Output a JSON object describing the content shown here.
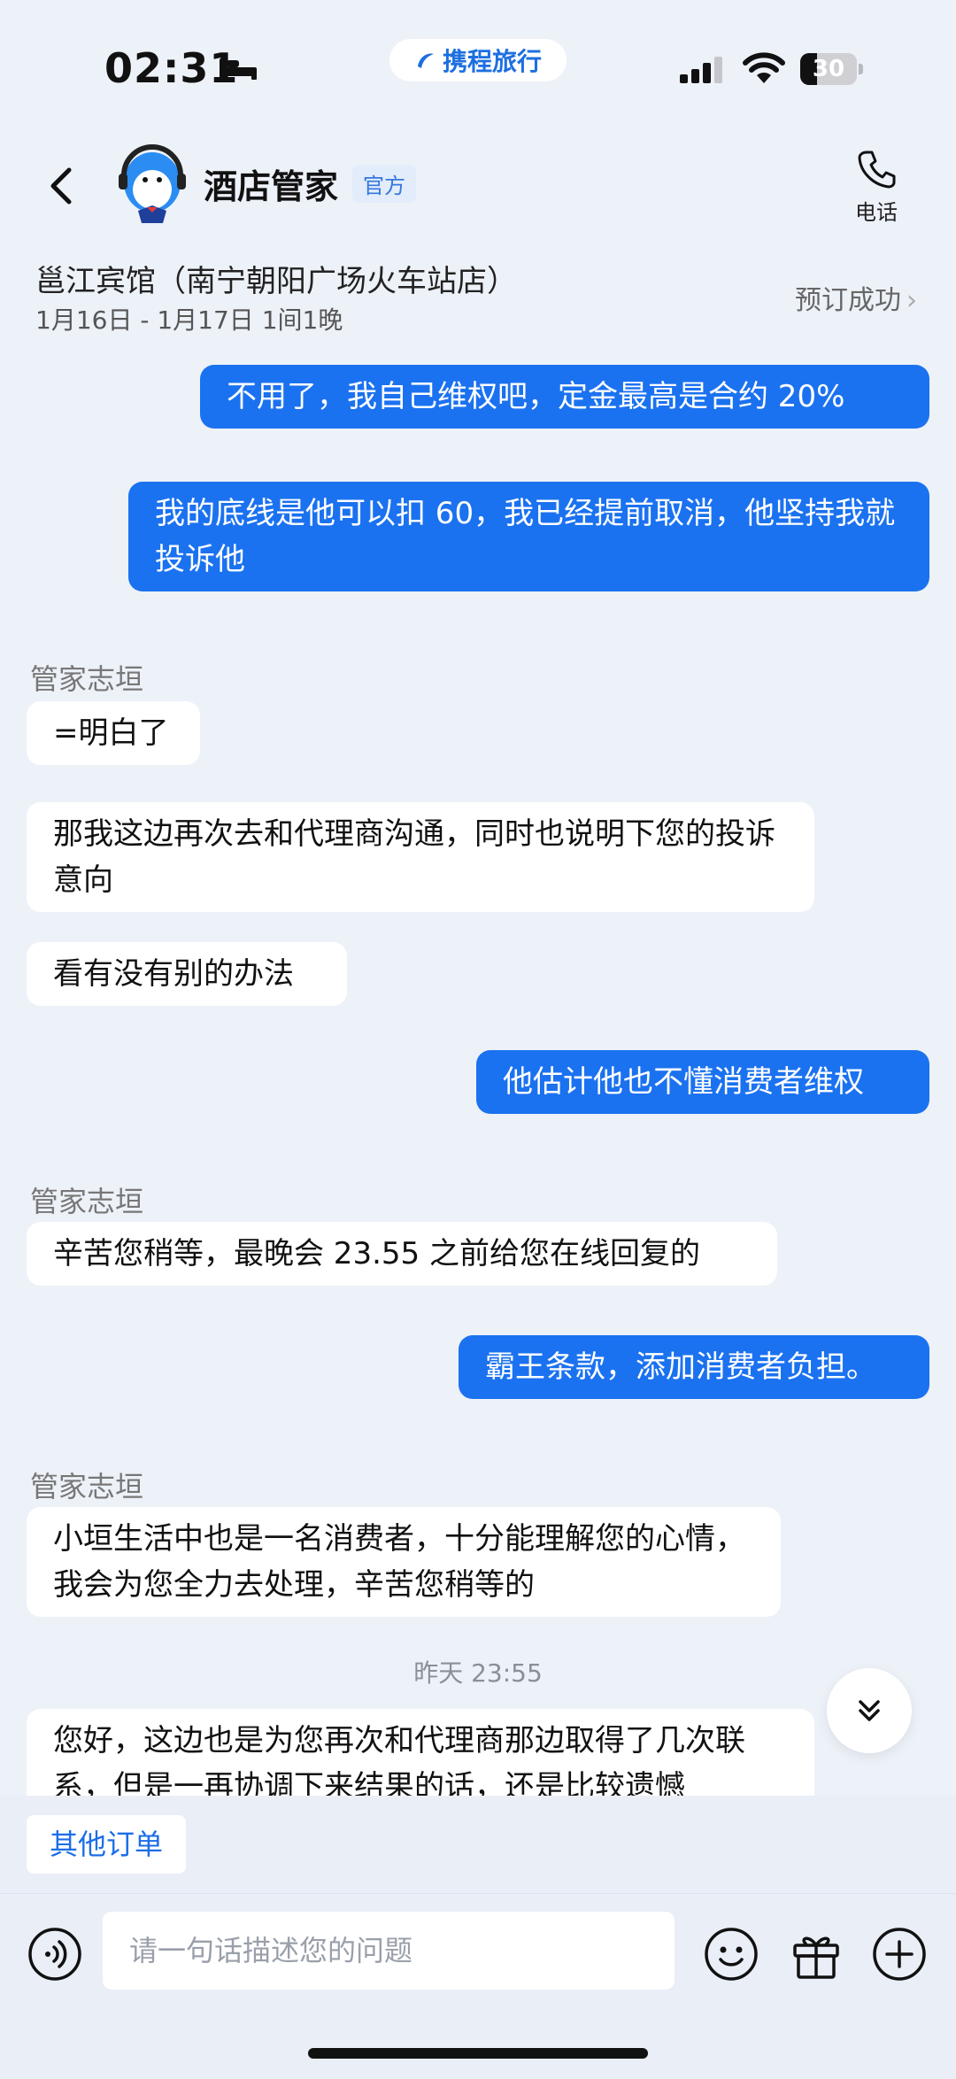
{
  "status_bar": {
    "time": "02:31",
    "battery": "30",
    "app_name": "携程旅行"
  },
  "header": {
    "title": "酒店管家",
    "badge": "官方",
    "phone_label": "电话"
  },
  "hotel": {
    "name": "邕江宾馆（南宁朝阳广场火车站店）",
    "dates": "1月16日 - 1月17日 1间1晚",
    "status": "预订成功"
  },
  "messages": {
    "m1": "不用了，我自己维权吧，定金最高是合约 20%",
    "m2": "我的底线是他可以扣 60，我已经提前取消，他坚持我就投诉他",
    "sender1": "管家志垣",
    "m3": "=明白了",
    "m4": "那我这边再次去和代理商沟通，同时也说明下您的投诉意向",
    "m5": "看有没有别的办法",
    "m6": "他估计他也不懂消费者维权",
    "sender2": "管家志垣",
    "m7": "辛苦您稍等，最晚会 23.55 之前给您在线回复的",
    "m8": "霸王条款，添加消费者负担。",
    "sender3": "管家志垣",
    "m9": "小垣生活中也是一名消费者，十分能理解您的心情，我会为您全力去处理，辛苦您稍等的",
    "timestamp": "昨天 23:55",
    "m10": "您好，这边也是为您再次和代理商那边取得了几次联系，但是一再协调下来结果的话，还是比较遗憾"
  },
  "quick_bar": {
    "other_orders": "其他订单"
  },
  "input": {
    "placeholder": "请一句话描述您的问题"
  }
}
